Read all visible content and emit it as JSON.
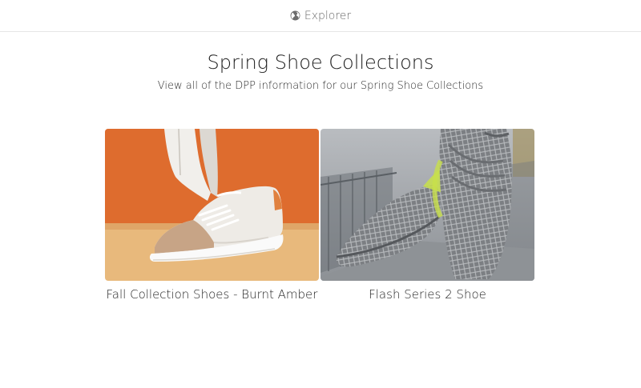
{
  "topbar": {
    "brand_label": "Explorer",
    "brand_icon": "globe-icon"
  },
  "header": {
    "title": "Spring Shoe Collections",
    "subtitle": "View all of the DPP information for our Spring Shoe Collections"
  },
  "collections": [
    {
      "label": "Fall Collection Shoes - Burnt Amber",
      "image": "white-tan-sneaker-orange-backdrop"
    },
    {
      "label": "Flash Series 2 Shoe",
      "image": "grey-mesh-sneakers-bridge"
    }
  ],
  "colors": {
    "accent_orange": "#d8622a",
    "divider": "#e6e6e6"
  }
}
